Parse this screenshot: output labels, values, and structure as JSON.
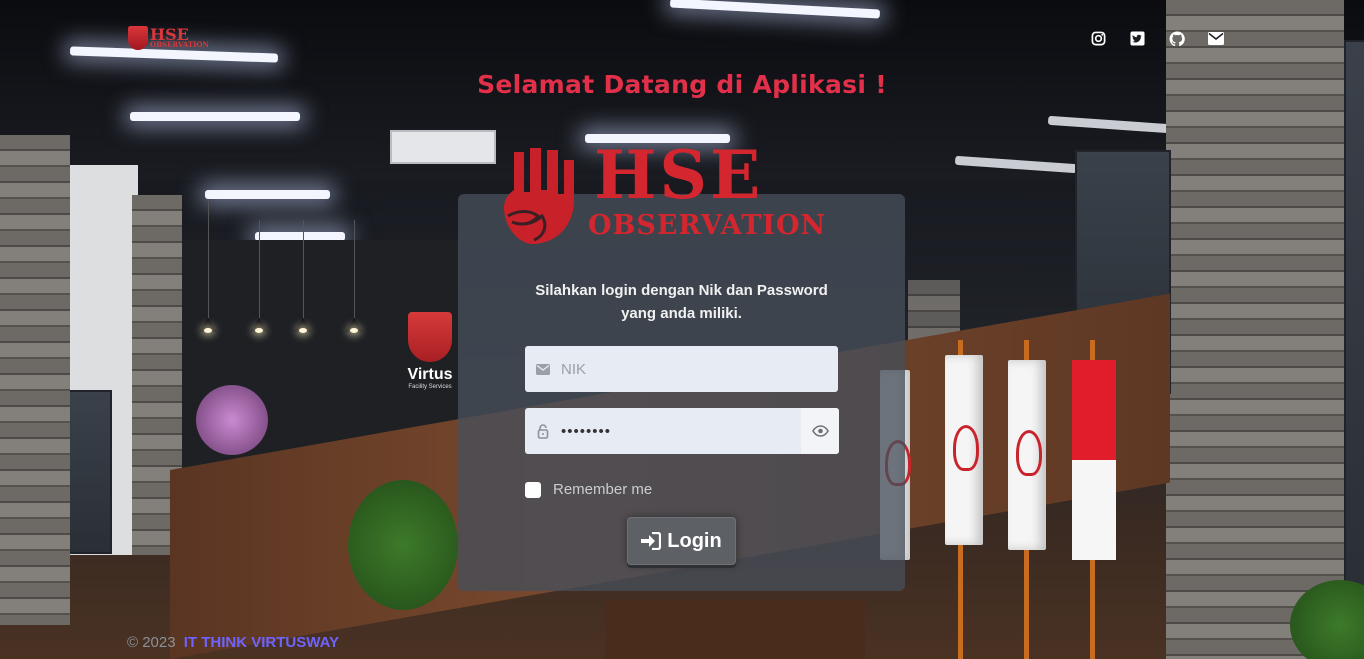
{
  "header": {
    "brand_line1": "HSE",
    "brand_line2": "OBSERVATION",
    "social_icons": [
      "instagram-icon",
      "twitter-icon",
      "github-icon",
      "envelope-icon"
    ]
  },
  "welcome_title": "Selamat Datang di Aplikasi !",
  "logo": {
    "line1": "HSE",
    "line2": "OBSERVATION"
  },
  "scene": {
    "wall_logo_word": "Virtus",
    "wall_logo_sub": "Facility Services"
  },
  "login": {
    "instruction_line1": "Silahkan login dengan Nik dan Password",
    "instruction_line2": "yang anda miliki.",
    "nik_placeholder": "NIK",
    "nik_value": "",
    "password_value": "••••••••",
    "remember_label": "Remember me",
    "remember_checked": false,
    "login_label": "Login"
  },
  "footer": {
    "copyright": "© 2023",
    "company": "IT THINK VIRTUSWAY"
  },
  "colors": {
    "accent_red": "#e2304a",
    "logo_red": "#d4262f",
    "footer_link": "#6f63ff"
  }
}
